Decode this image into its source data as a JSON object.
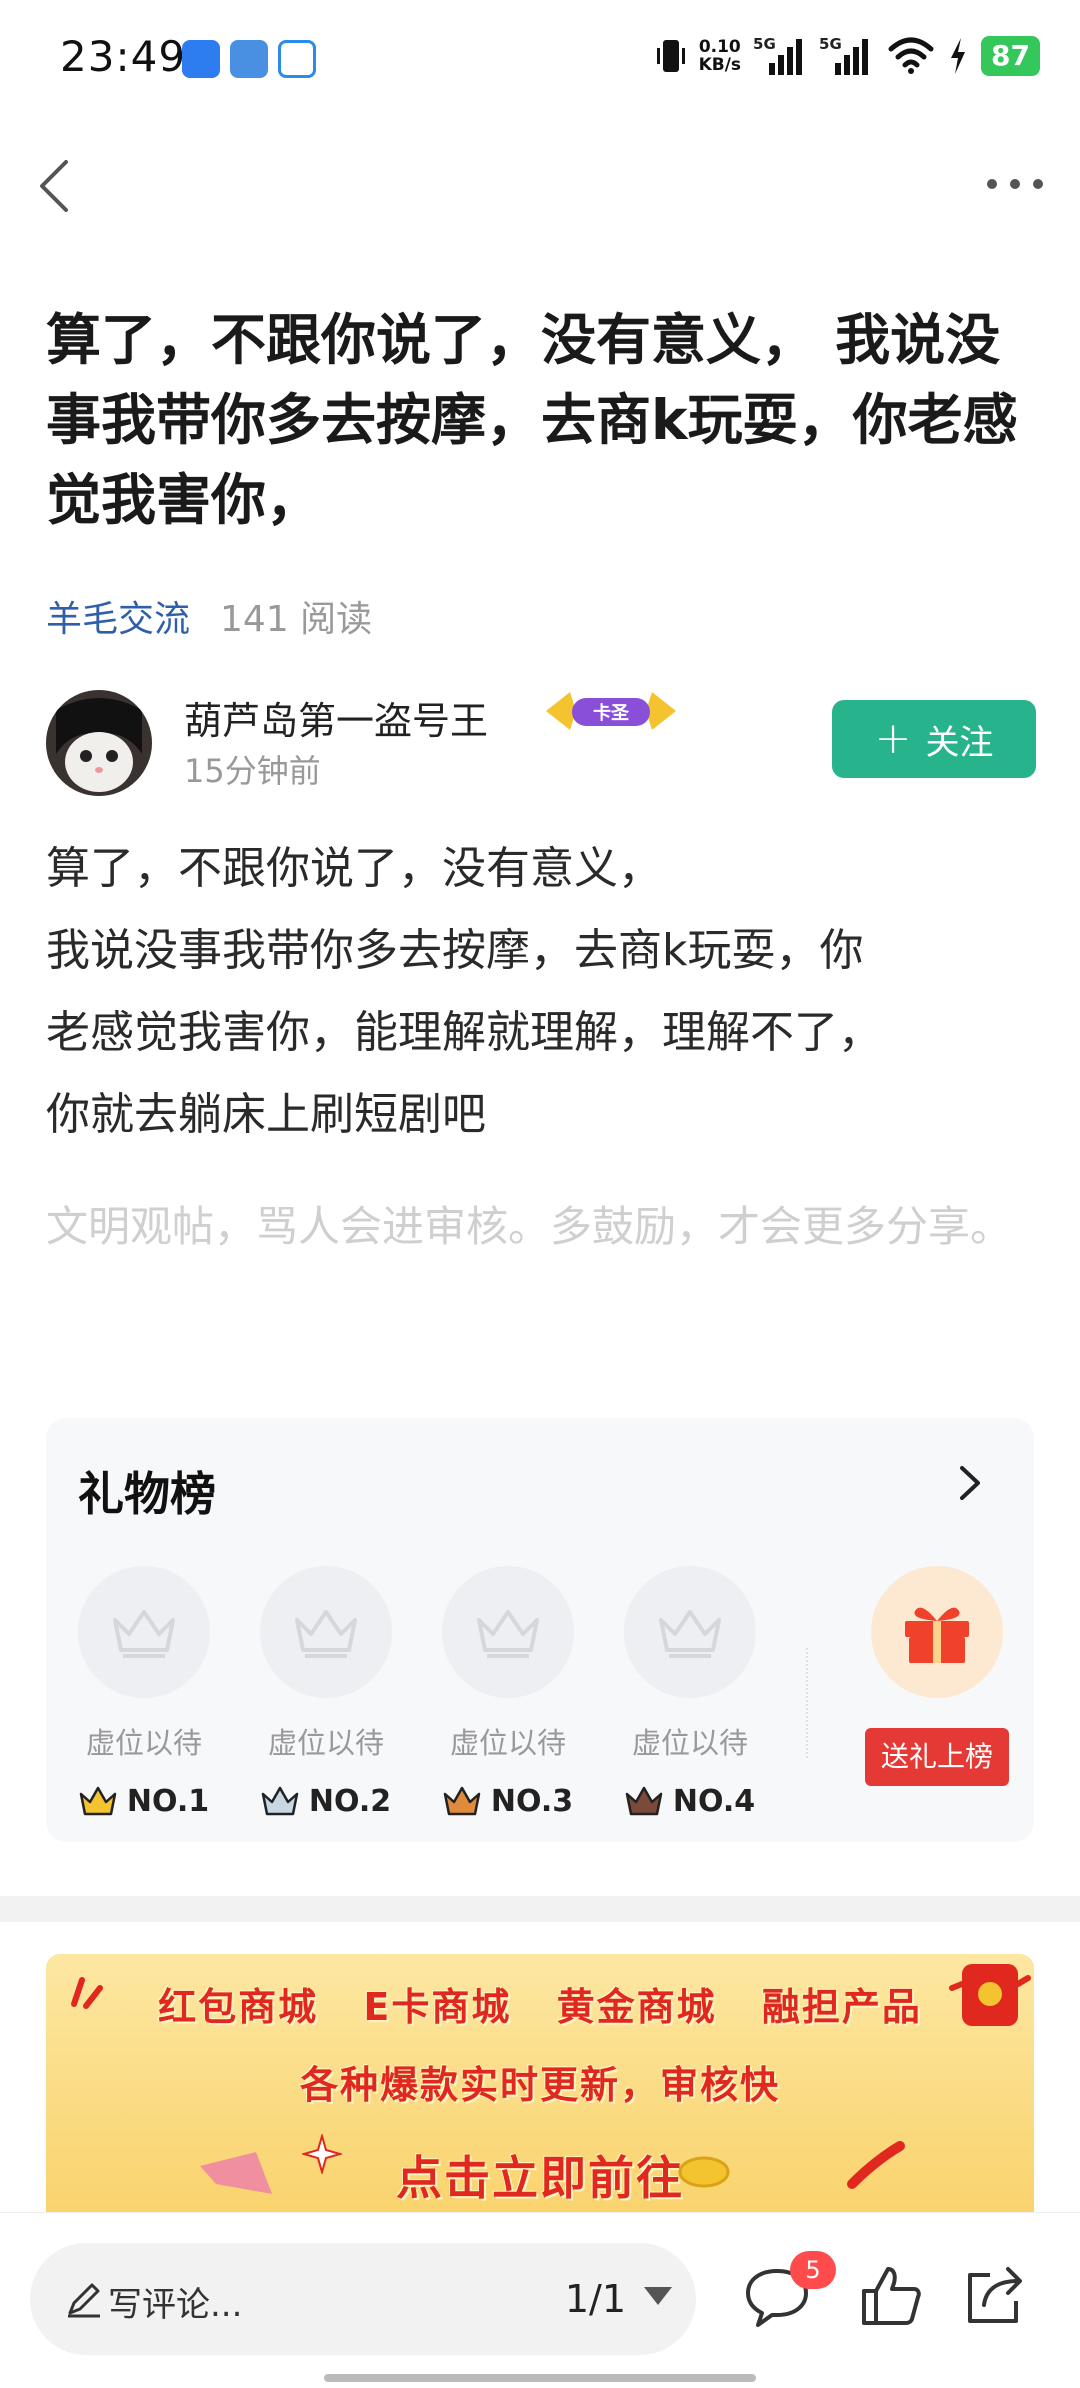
{
  "status_bar": {
    "time": "23:49",
    "net_speed_value": "0.10",
    "net_speed_unit": "KB/s",
    "signal1_label": "5G",
    "signal2_label": "5G",
    "battery": "87"
  },
  "post": {
    "title": "算了，不跟你说了，没有意义， 我说没事我带你多去按摩，去商k玩耍，你老感觉我害你，",
    "category": "羊毛交流",
    "reads": "141 阅读",
    "author_name": "葫芦岛第一盗号王",
    "author_badge": "卡圣",
    "author_time": "15分钟前",
    "follow_label": "关注",
    "body_lines": [
      "算了，不跟你说了，没有意义，",
      "我说没事我带你多去按摩，去商k玩耍，你",
      "老感觉我害你，能理解就理解，理解不了，",
      "你就去躺床上刷短剧吧"
    ],
    "hint": "文明观帖，骂人会进审核。多鼓励，才会更多分享。"
  },
  "gift_board": {
    "title": "礼物榜",
    "slots": [
      {
        "label": "虚位以待",
        "rank": "NO.1",
        "color": "#f4c430"
      },
      {
        "label": "虚位以待",
        "rank": "NO.2",
        "color": "#9fb3c8"
      },
      {
        "label": "虚位以待",
        "rank": "NO.3",
        "color": "#e08a3c"
      },
      {
        "label": "虚位以待",
        "rank": "NO.4",
        "color": "#7a4a3a"
      }
    ],
    "send_label": "送礼上榜"
  },
  "banner": {
    "line1": "红包商城 E卡商城 黄金商城 融担产品",
    "line2": "各种爆款实时更新，审核快",
    "line3": "点击立即前往"
  },
  "bottom_bar": {
    "comment_placeholder": "写评论...",
    "page_indicator": "1/1",
    "comment_count": "5"
  }
}
